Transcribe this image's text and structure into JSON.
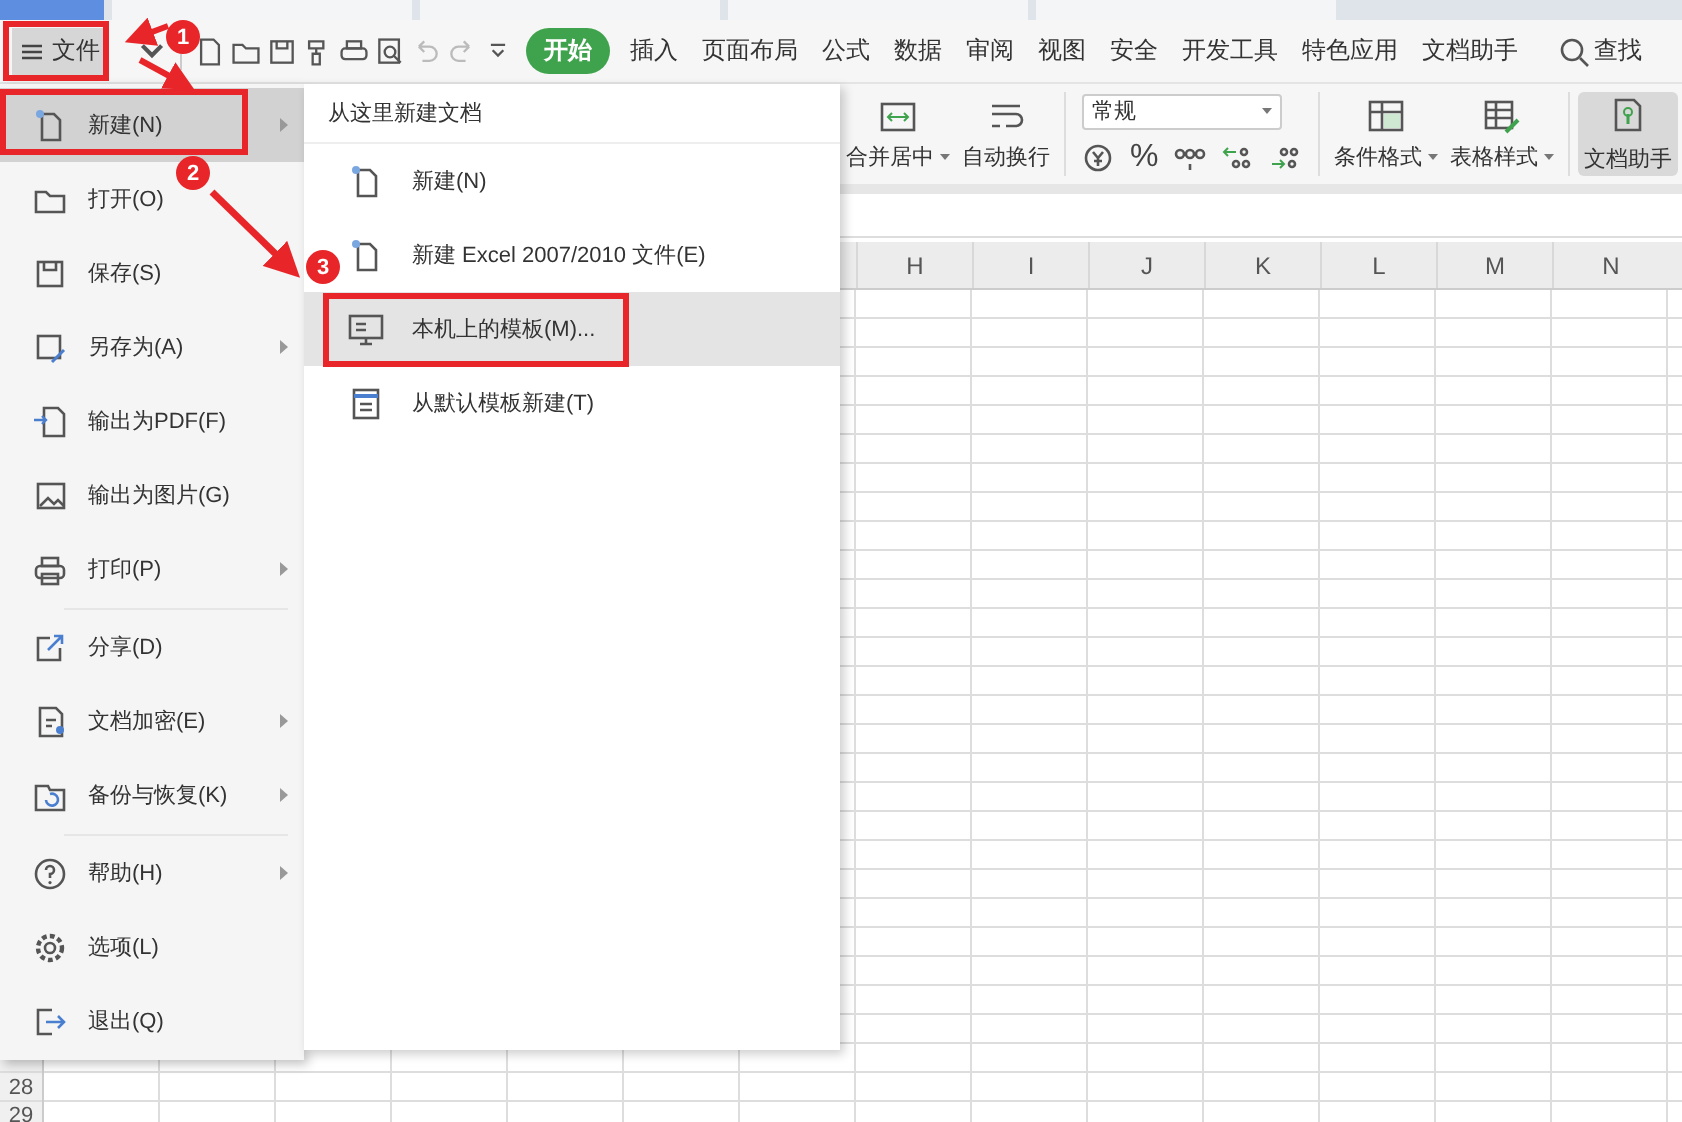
{
  "document_tabs": [
    {
      "selected": true
    },
    {
      "selected": false
    },
    {
      "selected": false
    },
    {
      "selected": false
    },
    {
      "selected": false
    }
  ],
  "file_button": {
    "label": "文件"
  },
  "menu_tabs": [
    {
      "label": "开始",
      "selected": true
    },
    {
      "label": "插入",
      "selected": false
    },
    {
      "label": "页面布局",
      "selected": false
    },
    {
      "label": "公式",
      "selected": false
    },
    {
      "label": "数据",
      "selected": false
    },
    {
      "label": "审阅",
      "selected": false
    },
    {
      "label": "视图",
      "selected": false
    },
    {
      "label": "安全",
      "selected": false
    },
    {
      "label": "开发工具",
      "selected": false
    },
    {
      "label": "特色应用",
      "selected": false
    },
    {
      "label": "文档助手",
      "selected": false
    }
  ],
  "search": {
    "label": "查找"
  },
  "ribbon": {
    "merge_button": {
      "label": "合并居中",
      "dropdown": true
    },
    "wrap_button": {
      "label": "自动换行",
      "dropdown": false
    },
    "number_format": "常规",
    "percent": "%",
    "style_buttons": [
      {
        "label": "条件格式",
        "dropdown": true
      },
      {
        "label": "表格样式",
        "dropdown": true
      }
    ],
    "assistant": {
      "label": "文档助手",
      "selected": true
    }
  },
  "sheet": {
    "columns": [
      "H",
      "I",
      "J",
      "K",
      "L",
      "M",
      "N"
    ],
    "row_numbers": [
      "28",
      "29"
    ]
  },
  "file_menu": {
    "groups": [
      [
        {
          "label": "新建(N)",
          "submenu": true,
          "selected": true
        },
        {
          "label": "打开(O)",
          "submenu": false,
          "selected": false
        },
        {
          "label": "保存(S)",
          "submenu": false,
          "selected": false
        },
        {
          "label": "另存为(A)",
          "submenu": true,
          "selected": false
        },
        {
          "label": "输出为PDF(F)",
          "submenu": false,
          "selected": false
        },
        {
          "label": "输出为图片(G)",
          "submenu": false,
          "selected": false
        },
        {
          "label": "打印(P)",
          "submenu": true,
          "selected": false
        }
      ],
      [
        {
          "label": "分享(D)",
          "submenu": false,
          "selected": false
        },
        {
          "label": "文档加密(E)",
          "submenu": true,
          "selected": false
        },
        {
          "label": "备份与恢复(K)",
          "submenu": true,
          "selected": false
        }
      ],
      [
        {
          "label": "帮助(H)",
          "submenu": true,
          "selected": false
        },
        {
          "label": "选项(L)",
          "submenu": false,
          "selected": false
        },
        {
          "label": "退出(Q)",
          "submenu": false,
          "selected": false
        }
      ]
    ]
  },
  "new_submenu": {
    "title": "从这里新建文档",
    "items": [
      {
        "label": "新建(N)",
        "selected": false
      },
      {
        "label": "新建 Excel 2007/2010 文件(E)",
        "selected": false
      },
      {
        "label": "本机上的模板(M)...",
        "selected": true
      },
      {
        "label": "从默认模板新建(T)",
        "selected": false
      }
    ]
  },
  "annotations": {
    "badges": [
      "1",
      "2",
      "3"
    ]
  }
}
